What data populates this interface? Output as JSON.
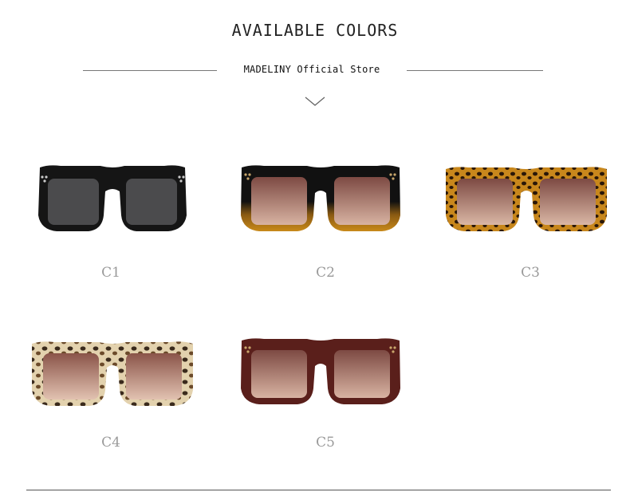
{
  "header": {
    "title": "AVAILABLE COLORS",
    "store": "MADELINY Official Store",
    "chevron_icon": "chevron-down-icon"
  },
  "products": [
    {
      "label": "C1",
      "frame": "#161616",
      "lens": "#4a4a4c"
    },
    {
      "label": "C2",
      "frame": "#141414",
      "lens": "#9e6a5e"
    },
    {
      "label": "C3",
      "frame": "#3a220f",
      "lens": "#a06e5f"
    },
    {
      "label": "C4",
      "frame": "#d9c7a3",
      "lens": "#b07a6a"
    },
    {
      "label": "C5",
      "frame": "#5a1f1b",
      "lens": "#a16d61"
    }
  ]
}
